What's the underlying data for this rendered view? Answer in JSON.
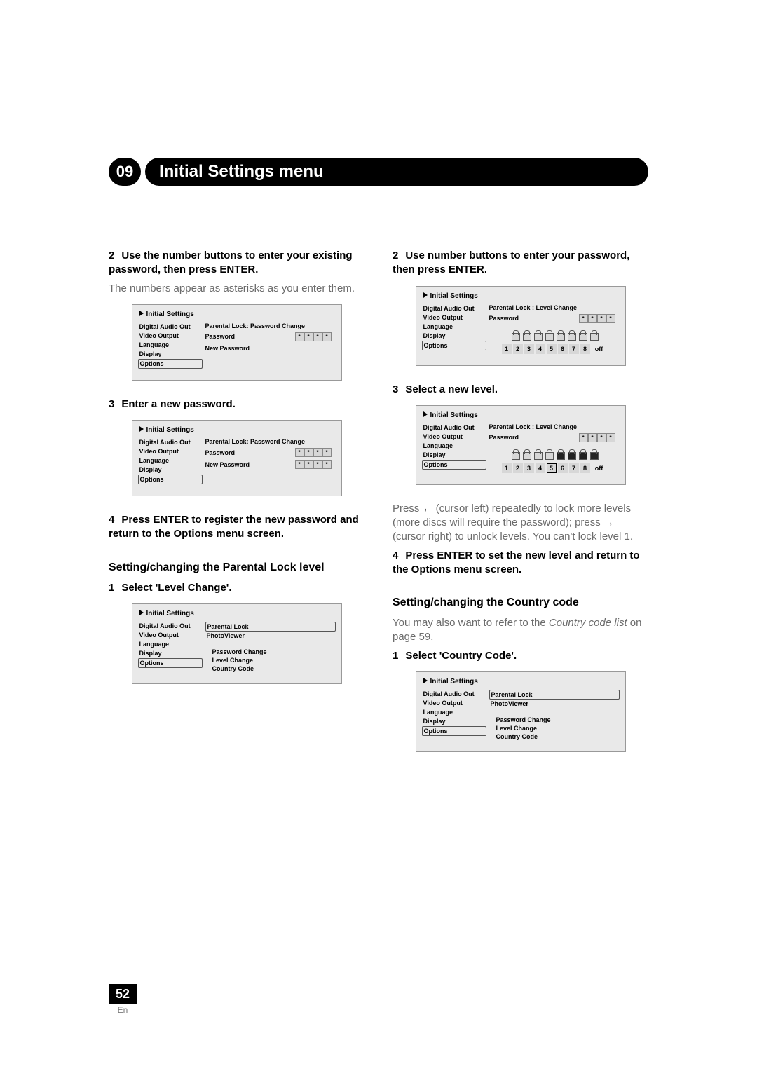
{
  "chapter": {
    "number": "09",
    "title": "Initial Settings menu"
  },
  "page": {
    "number": "52",
    "lang": "En"
  },
  "menu": {
    "title": "Initial Settings",
    "items": [
      "Digital Audio Out",
      "Video Output",
      "Language",
      "Display",
      "Options"
    ],
    "sub_items": [
      "Parental Lock",
      "PhotoViewer"
    ],
    "opts": [
      "Password Change",
      "Level Change",
      "Country Code"
    ]
  },
  "shot_pw": {
    "pane_title": "Parental Lock: Password Change",
    "row1": "Password",
    "row2": "New Password"
  },
  "shot_lvl": {
    "pane_title": "Parental Lock : Level Change",
    "row1": "Password",
    "nums": [
      "1",
      "2",
      "3",
      "4",
      "5",
      "6",
      "7",
      "8"
    ],
    "off": "off"
  },
  "left": {
    "s2a": "2",
    "s2b": "Use the number buttons to enter your existing password, then press ENTER.",
    "s2c": "The numbers appear as asterisks as you enter them.",
    "s3a": "3",
    "s3b": "Enter a new password.",
    "s4a": "4",
    "s4b": "Press ENTER to register the new password and return to the Options menu screen.",
    "h2": "Setting/changing the Parental Lock level",
    "s1a": "1",
    "s1b": "Select 'Level Change'."
  },
  "right": {
    "s2a": "2",
    "s2b": "Use number buttons to enter your password, then press ENTER.",
    "s3a": "3",
    "s3b": "Select a new level.",
    "p1a": "Press ",
    "p1b": " (cursor left) repeatedly to lock more levels (more discs will require the password); press ",
    "p1c": " (cursor right) to unlock levels. You can't lock level 1.",
    "s4a": "4",
    "s4b": "Press ENTER to set the new level and return to the Options menu screen.",
    "h2": "Setting/changing the Country code",
    "p2a": "You may also want to refer to the ",
    "p2b": "Country code list",
    "p2c": " on page 59.",
    "s1a": "1",
    "s1b": "Select 'Country Code'."
  }
}
